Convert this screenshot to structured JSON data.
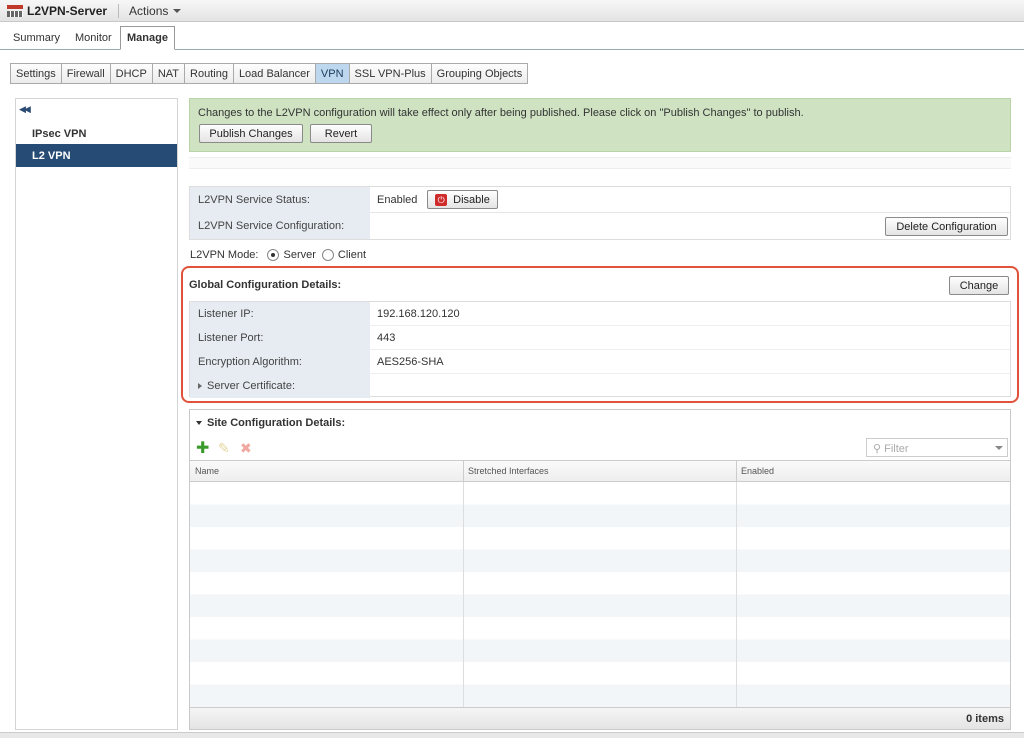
{
  "window": {
    "title": "L2VPN-Server",
    "actions_label": "Actions"
  },
  "main_tabs": [
    {
      "label": "Summary"
    },
    {
      "label": "Monitor"
    },
    {
      "label": "Manage"
    }
  ],
  "sub_tabs": [
    {
      "label": "Settings"
    },
    {
      "label": "Firewall"
    },
    {
      "label": "DHCP"
    },
    {
      "label": "NAT"
    },
    {
      "label": "Routing"
    },
    {
      "label": "Load Balancer"
    },
    {
      "label": "VPN"
    },
    {
      "label": "SSL VPN-Plus"
    },
    {
      "label": "Grouping Objects"
    }
  ],
  "sidebar": {
    "items": [
      {
        "label": "IPsec VPN"
      },
      {
        "label": "L2 VPN"
      }
    ]
  },
  "banner": {
    "message": "Changes to the L2VPN configuration will take effect only after being published. Please click on \"Publish Changes\" to publish.",
    "publish_label": "Publish Changes",
    "revert_label": "Revert"
  },
  "service": {
    "status_label": "L2VPN Service Status:",
    "status_value": "Enabled",
    "disable_label": "Disable",
    "config_label": "L2VPN Service Configuration:",
    "delete_label": "Delete Configuration"
  },
  "mode": {
    "label": "L2VPN Mode:",
    "server_label": "Server",
    "client_label": "Client",
    "selected": "Server"
  },
  "global_config": {
    "title": "Global Configuration Details:",
    "change_label": "Change",
    "rows": [
      {
        "label": "Listener IP:",
        "value": "192.168.120.120"
      },
      {
        "label": "Listener Port:",
        "value": "443"
      },
      {
        "label": "Encryption Algorithm:",
        "value": "AES256-SHA"
      },
      {
        "label": "Server Certificate:",
        "value": ""
      }
    ]
  },
  "site_config": {
    "title": "Site Configuration Details:",
    "filter_placeholder": "Filter",
    "columns": [
      "Name",
      "Stretched Interfaces",
      "Enabled"
    ],
    "item_count": "0 items"
  },
  "colors": {
    "accent": "#264b74",
    "banner_bg": "#cfe3c2",
    "highlight": "#e0533a",
    "disable_icon": "#d02b2b",
    "add_icon": "#3a9b2b"
  }
}
